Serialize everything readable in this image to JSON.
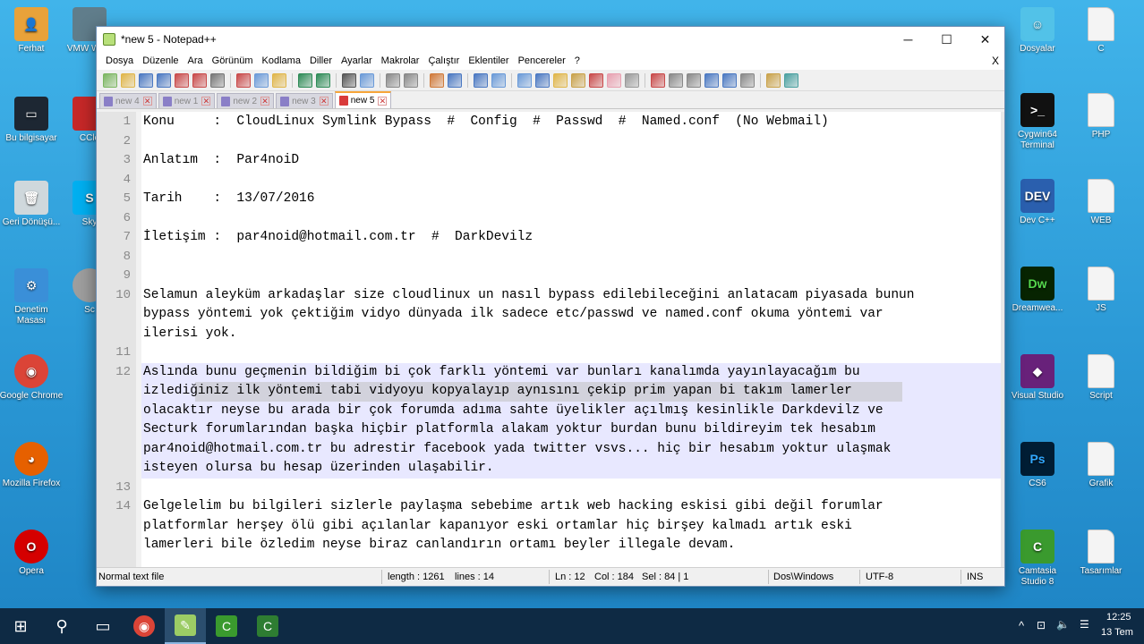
{
  "desktop": {
    "left_icons": [
      {
        "label": "Ferhat",
        "icon": "user-folder-icon"
      },
      {
        "label": "Bu bilgisayar",
        "icon": "computer-icon"
      },
      {
        "label": "Geri Dönüşü...",
        "icon": "recycle-bin-icon"
      },
      {
        "label": "Denetim Masası",
        "icon": "control-panel-icon"
      },
      {
        "label": "Google Chrome",
        "icon": "chrome-icon"
      },
      {
        "label": "Mozilla Firefox",
        "icon": "firefox-icon"
      },
      {
        "label": "Opera",
        "icon": "opera-icon"
      }
    ],
    "left_partial_icons": [
      {
        "label": "VMW Work",
        "icon": "vmware-icon"
      },
      {
        "label": "CCle",
        "icon": "ccleaner-icon"
      },
      {
        "label": "Sky",
        "icon": "skype-icon"
      },
      {
        "label": "Sc",
        "icon": "disk-icon"
      }
    ],
    "right_icons": [
      {
        "label": "Dosyalar",
        "icon": "folder-icon"
      },
      {
        "label": "C",
        "icon": "document-icon"
      },
      {
        "label": "Cygwin64 Terminal",
        "icon": "terminal-icon"
      },
      {
        "label": "PHP",
        "icon": "document-icon"
      },
      {
        "label": "Dev C++",
        "icon": "devcpp-icon"
      },
      {
        "label": "WEB",
        "icon": "document-icon"
      },
      {
        "label": "Dreamwea...",
        "icon": "dreamweaver-icon"
      },
      {
        "label": "JS",
        "icon": "document-icon"
      },
      {
        "label": "Visual Studio",
        "icon": "visual-studio-icon"
      },
      {
        "label": "Script",
        "icon": "document-icon"
      },
      {
        "label": "CS6",
        "icon": "photoshop-icon"
      },
      {
        "label": "Grafik",
        "icon": "document-icon"
      },
      {
        "label": "Camtasia Studio 8",
        "icon": "camtasia-icon"
      },
      {
        "label": "Tasarımlar",
        "icon": "document-icon"
      }
    ]
  },
  "window": {
    "title": "*new 5 - Notepad++",
    "controls": {
      "minimize": "─",
      "maximize": "☐",
      "close": "✕"
    },
    "menu": [
      "Dosya",
      "Düzenle",
      "Ara",
      "Görünüm",
      "Kodlama",
      "Diller",
      "Ayarlar",
      "Makrolar",
      "Çalıştır",
      "Eklentiler",
      "Pencereler",
      "?"
    ],
    "menu_close": "X",
    "tabs": [
      {
        "label": "new 4",
        "active": false
      },
      {
        "label": "new 1",
        "active": false
      },
      {
        "label": "new 2",
        "active": false
      },
      {
        "label": "new 3",
        "active": false
      },
      {
        "label": "new 5",
        "active": true
      }
    ],
    "tab_close": "✕"
  },
  "editor": {
    "current_line": 12,
    "lines": [
      {
        "n": "1",
        "rows": [
          "Konu     :  CloudLinux Symlink Bypass  #  Config  #  Passwd  #  Named.conf  (No Webmail)"
        ]
      },
      {
        "n": "2",
        "rows": [
          ""
        ]
      },
      {
        "n": "3",
        "rows": [
          "Anlatım  :  Par4noiD"
        ]
      },
      {
        "n": "4",
        "rows": [
          ""
        ]
      },
      {
        "n": "5",
        "rows": [
          "Tarih    :  13/07/2016"
        ]
      },
      {
        "n": "6",
        "rows": [
          ""
        ]
      },
      {
        "n": "7",
        "rows": [
          "İletişim :  par4noid@hotmail.com.tr  #  DarkDevilz"
        ]
      },
      {
        "n": "8",
        "rows": [
          ""
        ]
      },
      {
        "n": "9",
        "rows": [
          ""
        ]
      },
      {
        "n": "10",
        "rows": [
          "Selamun aleyküm arkadaşlar size cloudlinux un nasıl bypass edilebileceğini anlatacam piyasada bunun",
          "bypass yöntemi yok çektiğim vidyo dünyada ilk sadece etc/passwd ve named.conf okuma yöntemi var",
          "ilerisi yok."
        ]
      },
      {
        "n": "11",
        "rows": [
          ""
        ]
      },
      {
        "n": "12",
        "rows": [
          "Aslında bunu geçmenin bildiğim bi çok farklı yöntemi var bunları kanalımda yayınlayacağım bu",
          "izlediğiniz ilk yöntemi tabi vidyoyu kopyalayıp aynısını çekip prim yapan bi takım lamerler",
          "olacaktır neyse bu arada bir çok forumda adıma sahte üyelikler açılmış kesinlikle Darkdevilz ve",
          "Secturk forumlarından başka hiçbir platformla alakam yoktur burdan bunu bildireyim tek hesabım",
          "par4noid@hotmail.com.tr bu adrestir facebook yada twitter vsvs... hiç bir hesabım yoktur ulaşmak",
          "isteyen olursa bu hesap üzerinden ulaşabilir."
        ]
      },
      {
        "n": "13",
        "rows": [
          ""
        ]
      },
      {
        "n": "14",
        "rows": [
          "Gelgelelim bu bilgileri sizlerle paylaşma sebebime artık web hacking eskisi gibi değil forumlar",
          "platformlar herşey ölü gibi açılanlar kapanıyor eski ortamlar hiç birşey kalmadı artık eski",
          "lamerleri bile özledim neyse biraz canlandırın ortamı beyler illegale devam."
        ]
      }
    ]
  },
  "status": {
    "file_type": "Normal text file",
    "length": "length : 1261",
    "lines": "lines : 14",
    "ln": "Ln : 12",
    "col": "Col : 184",
    "sel": "Sel : 84 | 1",
    "eol": "Dos\\Windows",
    "encoding": "UTF-8",
    "mode": "INS"
  },
  "taskbar": {
    "apps": [
      "start-icon",
      "search-icon",
      "task-view-icon",
      "chrome-icon",
      "notepadpp-icon",
      "camtasia-icon",
      "camtasia-recorder-icon"
    ],
    "time": "12:25",
    "date": "13 Tem"
  }
}
